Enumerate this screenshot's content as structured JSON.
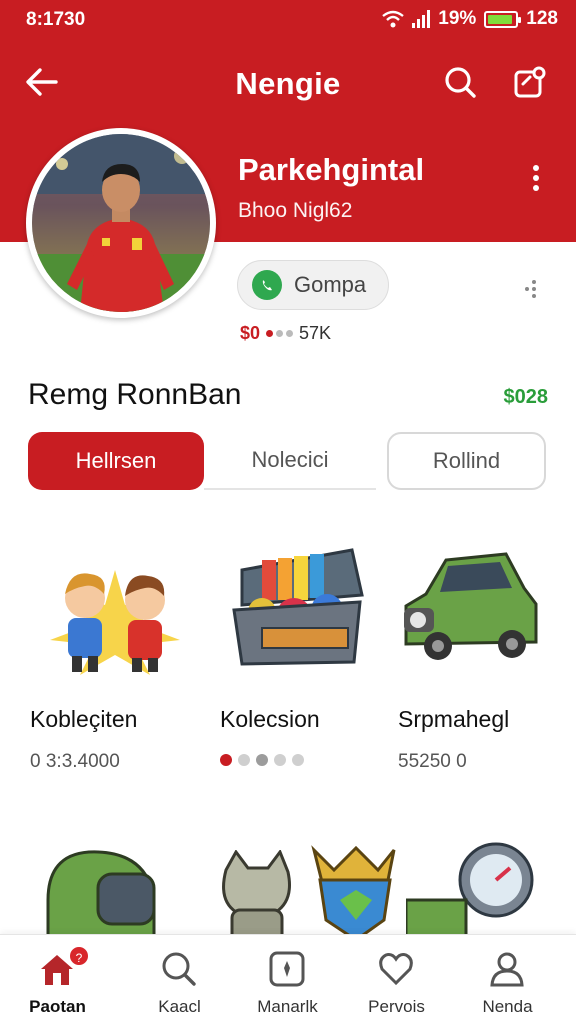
{
  "status_bar": {
    "time": "8:1730",
    "battery": "19%",
    "extra": "128"
  },
  "app_bar": {
    "title": "Nengie"
  },
  "profile": {
    "name": "Parkehgintal",
    "handle": "Bhoo Nigl62",
    "follow_chip_label": "Gompa",
    "stat_money": "$0",
    "stat_count": "57K"
  },
  "section": {
    "title": "Remg RonnBan",
    "amount": "$028"
  },
  "tabs": [
    {
      "label": "Hellrsen",
      "active": true
    },
    {
      "label": "Nolecici",
      "active": false
    },
    {
      "label": "Rollind",
      "active": false
    }
  ],
  "items": [
    {
      "name": "Kobleçiten",
      "sub": "0 3:3.4000",
      "icon": "two-boys-illustration"
    },
    {
      "name": "Kolecsion",
      "pager_active": 0,
      "icon": "treasure-chest-illustration"
    },
    {
      "name": "Srpmahegl",
      "sub": "55250  0",
      "icon": "green-car-illustration"
    }
  ],
  "row2_icons": [
    "green-helmet-illustration",
    "cat-figure-illustration",
    "trophy-shield-illustration",
    "gauge-machine-illustration"
  ],
  "bottom_nav": [
    {
      "label": "Paotan",
      "icon": "home-icon",
      "active": true,
      "badge": "?"
    },
    {
      "label": "Kaacl",
      "icon": "search-icon",
      "active": false
    },
    {
      "label": "Manarlk",
      "icon": "star-card-icon",
      "active": false
    },
    {
      "label": "Pervois",
      "icon": "heart-icon",
      "active": false
    },
    {
      "label": "Nenda",
      "icon": "user-icon",
      "active": false
    }
  ],
  "colors": {
    "brand_red": "#c81d22",
    "accent_green": "#2a9d3a"
  }
}
